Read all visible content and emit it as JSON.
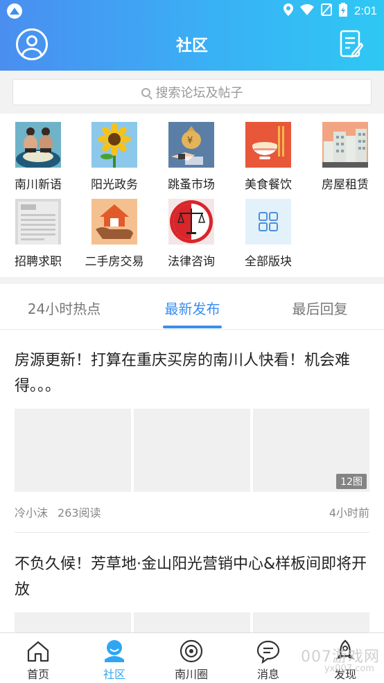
{
  "status_bar": {
    "time": "2:01"
  },
  "header": {
    "title": "社区"
  },
  "search": {
    "placeholder": "搜索论坛及帖子"
  },
  "categories": [
    {
      "label": "南川新语",
      "icon": "sumo-wrestlers-icon"
    },
    {
      "label": "阳光政务",
      "icon": "sunflower-icon"
    },
    {
      "label": "跳蚤市场",
      "icon": "money-bag-icon"
    },
    {
      "label": "美食餐饮",
      "icon": "food-bowl-icon"
    },
    {
      "label": "房屋租赁",
      "icon": "buildings-icon"
    },
    {
      "label": "招聘求职",
      "icon": "newspaper-icon"
    },
    {
      "label": "二手房交易",
      "icon": "house-hand-icon"
    },
    {
      "label": "法律咨询",
      "icon": "scales-icon"
    },
    {
      "label": "全部版块",
      "icon": "grid-icon"
    }
  ],
  "tabs": [
    {
      "label": "24小时热点",
      "active": false
    },
    {
      "label": "最新发布",
      "active": true
    },
    {
      "label": "最后回复",
      "active": false
    }
  ],
  "posts": [
    {
      "title": "房源更新！打算在重庆买房的南川人快看！机会难得。。。",
      "author": "冷小沫",
      "reads": "263阅读",
      "time": "4小时前",
      "image_count": "12图"
    },
    {
      "title": "不负久候！芳草地·金山阳光营销中心&样板间即将开放"
    }
  ],
  "bottom_nav": [
    {
      "label": "首页",
      "icon": "home-icon",
      "active": false
    },
    {
      "label": "社区",
      "icon": "community-icon",
      "active": true
    },
    {
      "label": "南川圈",
      "icon": "circle-icon",
      "active": false
    },
    {
      "label": "消息",
      "icon": "message-icon",
      "active": false
    },
    {
      "label": "发现",
      "icon": "rocket-icon",
      "active": false
    }
  ],
  "watermark": {
    "text": "007游戏网",
    "url": "yx007.com"
  },
  "colors": {
    "accent": "#3a8ef0",
    "header_start": "#4a8ef0",
    "header_end": "#2ec8f4"
  }
}
